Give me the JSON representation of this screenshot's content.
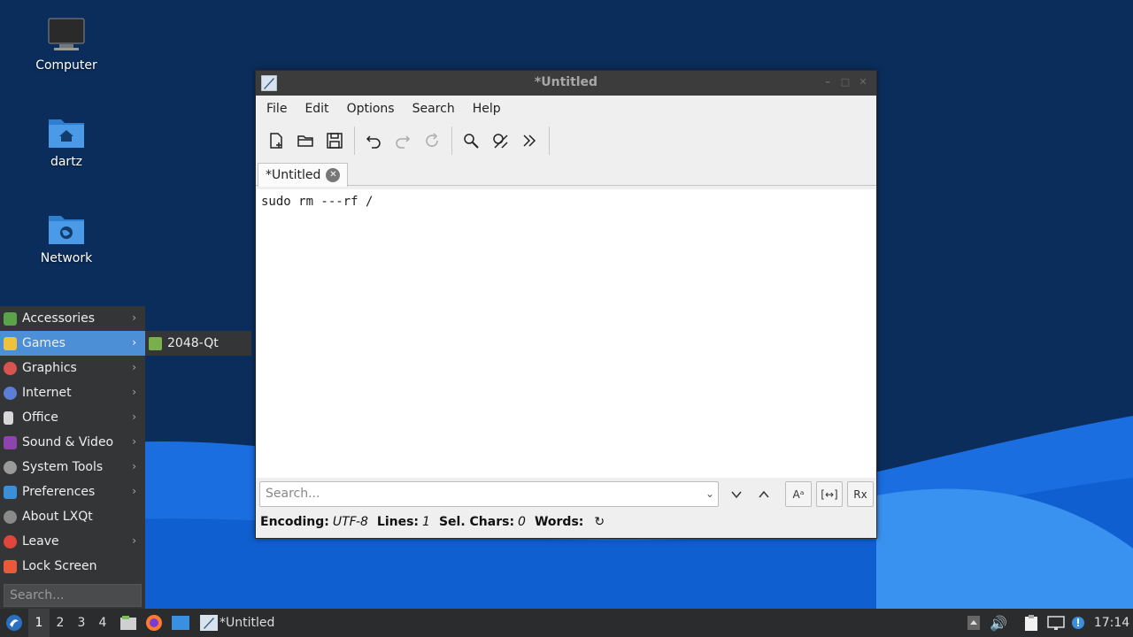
{
  "desktop": {
    "icons": [
      {
        "label": "Computer"
      },
      {
        "label": "dartz"
      },
      {
        "label": "Network"
      }
    ]
  },
  "window": {
    "title": "*Untitled",
    "menu": [
      "File",
      "Edit",
      "Options",
      "Search",
      "Help"
    ],
    "tab_label": "*Untitled",
    "editor_text": "sudo rm ---rf /",
    "search_placeholder": "Search...",
    "search_buttons": {
      "case": "Aᵃ",
      "whole": "[↔]",
      "regex": "Rx"
    },
    "status": {
      "encoding_label": "Encoding:",
      "encoding_value": "UTF-8",
      "lines_label": "Lines:",
      "lines_value": "1",
      "sel_label": "Sel. Chars:",
      "sel_value": "0",
      "words_label": "Words:"
    }
  },
  "start_menu": {
    "items": [
      {
        "label": "Accessories",
        "color": "#5aa34a"
      },
      {
        "label": "Games",
        "color": "#f0c23c"
      },
      {
        "label": "Graphics",
        "color": "#d9534f"
      },
      {
        "label": "Internet",
        "color": "#5b7fd6"
      },
      {
        "label": "Office",
        "color": "#d8d8d8"
      },
      {
        "label": "Sound & Video",
        "color": "#8e44ad"
      },
      {
        "label": "System Tools",
        "color": "#9a9a9a"
      },
      {
        "label": "Preferences",
        "color": "#3a8fd6"
      },
      {
        "label": "About LXQt",
        "color": "#8a8a8a"
      },
      {
        "label": "Leave",
        "color": "#e0463a"
      },
      {
        "label": "Lock Screen",
        "color": "#e85a3a"
      }
    ],
    "search_placeholder": "Search...",
    "submenu_item": "2048-Qt"
  },
  "taskbar": {
    "desktops": [
      "1",
      "2",
      "3",
      "4"
    ],
    "task_label": "*Untitled",
    "clock": "17:14"
  }
}
